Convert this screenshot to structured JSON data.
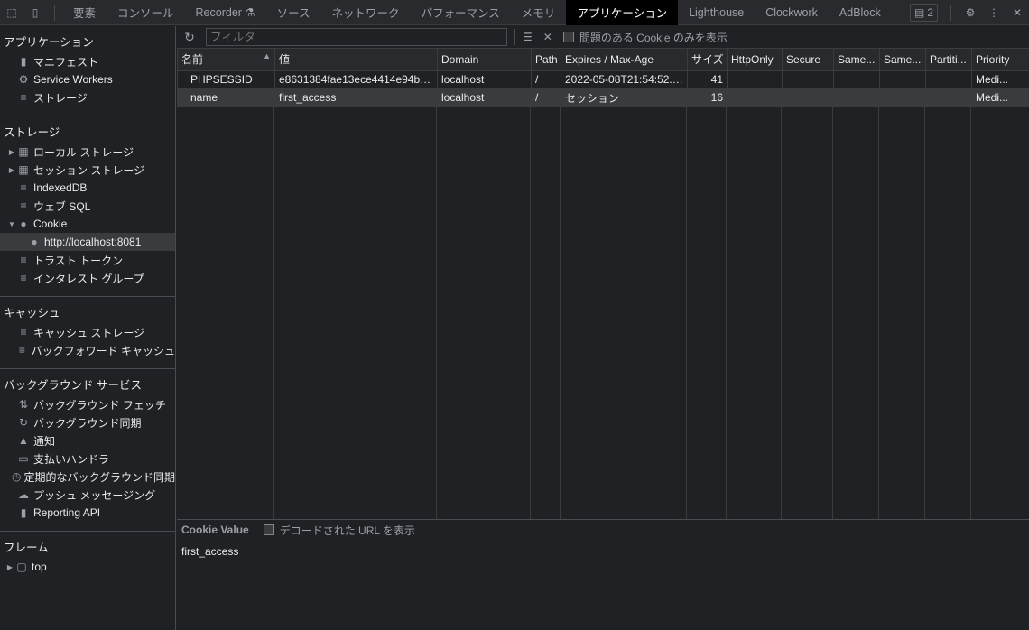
{
  "topbar": {
    "tabs": [
      {
        "label": "要素",
        "active": false
      },
      {
        "label": "コンソール",
        "active": false
      },
      {
        "label": "Recorder ⚗",
        "active": false
      },
      {
        "label": "ソース",
        "active": false
      },
      {
        "label": "ネットワーク",
        "active": false
      },
      {
        "label": "パフォーマンス",
        "active": false
      },
      {
        "label": "メモリ",
        "active": false
      },
      {
        "label": "アプリケーション",
        "active": true
      },
      {
        "label": "Lighthouse",
        "active": false
      },
      {
        "label": "Clockwork",
        "active": false
      },
      {
        "label": "AdBlock",
        "active": false
      }
    ],
    "issues_count": "2"
  },
  "sidebar": {
    "sections": {
      "application": {
        "title": "アプリケーション",
        "items": [
          "マニフェスト",
          "Service Workers",
          "ストレージ"
        ]
      },
      "storage": {
        "title": "ストレージ",
        "items": [
          "ローカル ストレージ",
          "セッション ストレージ",
          "IndexedDB",
          "ウェブ SQL",
          "Cookie",
          "http://localhost:8081",
          "トラスト トークン",
          "インタレスト グループ"
        ]
      },
      "cache": {
        "title": "キャッシュ",
        "items": [
          "キャッシュ ストレージ",
          "バックフォワード キャッシュ"
        ]
      },
      "background": {
        "title": "バックグラウンド サービス",
        "items": [
          "バックグラウンド フェッチ",
          "バックグラウンド同期",
          "通知",
          "支払いハンドラ",
          "定期的なバックグラウンド同期",
          "プッシュ メッセージング",
          "Reporting API"
        ]
      },
      "frames": {
        "title": "フレーム",
        "items": [
          "top"
        ]
      }
    }
  },
  "toolbar": {
    "filter_placeholder": "フィルタ",
    "only_issues_label": "問題のある Cookie のみを表示"
  },
  "table": {
    "columns": [
      "名前",
      "値",
      "Domain",
      "Path",
      "Expires / Max-Age",
      "サイズ",
      "HttpOnly",
      "Secure",
      "Same...",
      "Same...",
      "Partiti...",
      "Priority"
    ],
    "rows": [
      [
        "PHPSESSID",
        "e8631384fae13ece4414e94b3...",
        "localhost",
        "/",
        "2022-05-08T21:54:52.0...",
        "41",
        "",
        "",
        "",
        "",
        "",
        "Medi..."
      ],
      [
        "name",
        "first_access",
        "localhost",
        "/",
        "セッション",
        "16",
        "",
        "",
        "",
        "",
        "",
        "Medi..."
      ]
    ],
    "selected_row": 1
  },
  "value_panel": {
    "title": "Cookie Value",
    "decode_label": "デコードされた URL を表示",
    "value": "first_access"
  }
}
